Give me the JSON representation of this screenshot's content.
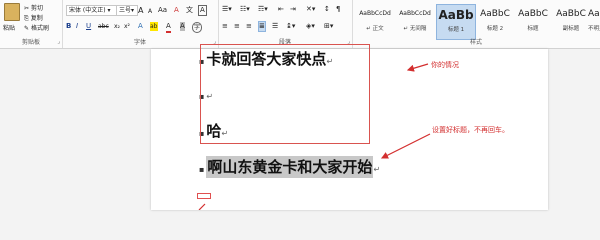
{
  "ribbon": {
    "clipboard": {
      "paste": "粘贴",
      "cut": "剪切",
      "copy": "复制",
      "format_painter": "格式刷",
      "group_label": "剪贴板"
    },
    "font": {
      "font_name": "宋体 (中文正)",
      "font_size": "三号",
      "grow": "A",
      "shrink": "A",
      "case": "Aa",
      "clear": "A",
      "wen": "文",
      "phonetic": "A",
      "bold": "B",
      "italic": "I",
      "underline": "U",
      "strike": "abc",
      "subscript": "x₂",
      "superscript": "x²",
      "effects": "A",
      "highlight": "ab",
      "color": "A",
      "char_shade": "A",
      "enclose": "字",
      "group_label": "字体"
    },
    "paragraph": {
      "group_label": "段落"
    },
    "styles": {
      "group_label": "样式",
      "items": [
        {
          "preview": "AaBbCcDd",
          "name": "↵ 正文"
        },
        {
          "preview": "AaBbCcDd",
          "name": "↵ 无间隔"
        },
        {
          "preview": "AaBb",
          "name": "标题 1"
        },
        {
          "preview": "AaBbC",
          "name": "标题 2"
        },
        {
          "preview": "AaBbC",
          "name": "标题"
        },
        {
          "preview": "AaBbC",
          "name": "副标题"
        },
        {
          "preview": "AaBbC",
          "name": "不明显"
        }
      ]
    }
  },
  "document": {
    "line1": "卡就回答大家快点",
    "line2": "",
    "line3": "哈",
    "line4": "啊山东黄金卡和大家开始"
  },
  "annotations": {
    "note1": "你的情况",
    "note2": "设置好标题，不再回车。"
  },
  "colors": {
    "accent_red": "#d32f2f",
    "highlight_gray": "#c8c8c8"
  }
}
